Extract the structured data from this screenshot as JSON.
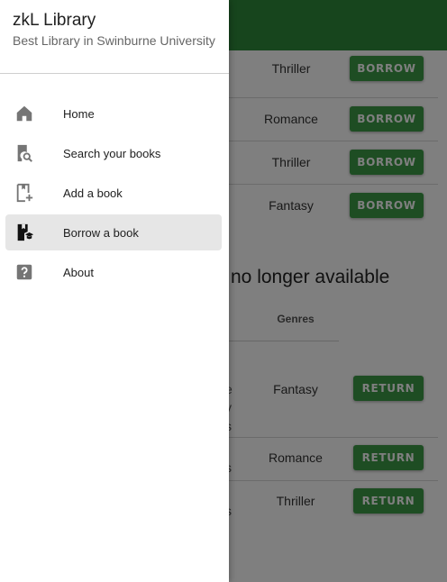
{
  "drawer": {
    "title": "zkL Library",
    "subtitle": "Best Library in Swinburne University",
    "items": [
      {
        "label": "Home",
        "icon": "home-icon",
        "active": false
      },
      {
        "label": "Search your books",
        "icon": "book-search-icon",
        "active": false
      },
      {
        "label": "Add a book",
        "icon": "book-add-icon",
        "active": false
      },
      {
        "label": "Borrow a book",
        "icon": "book-borrow-icon",
        "active": true
      },
      {
        "label": "About",
        "icon": "help-icon",
        "active": false
      }
    ]
  },
  "available": {
    "rows": [
      {
        "genre": "Thriller",
        "action": "BORROW"
      },
      {
        "genre": "Romance",
        "action": "BORROW"
      },
      {
        "genre": "Thriller",
        "action": "BORROW"
      },
      {
        "genre": "Fantasy",
        "action": "BORROW"
      }
    ]
  },
  "unavailable": {
    "title_fragment": "no longer available",
    "genres_header": "Genres",
    "rows": [
      {
        "genre": "Fantasy",
        "action": "RETURN",
        "fragments": [
          "e",
          "y",
          "s"
        ]
      },
      {
        "genre": "Romance",
        "action": "RETURN",
        "fragments": [
          "s"
        ]
      },
      {
        "genre": "Thriller",
        "action": "RETURN",
        "fragments": [
          "s"
        ]
      }
    ]
  },
  "colors": {
    "appbar": "#2e8b3a",
    "button": "#3d9a47",
    "active_item": "#e6e6e6"
  }
}
